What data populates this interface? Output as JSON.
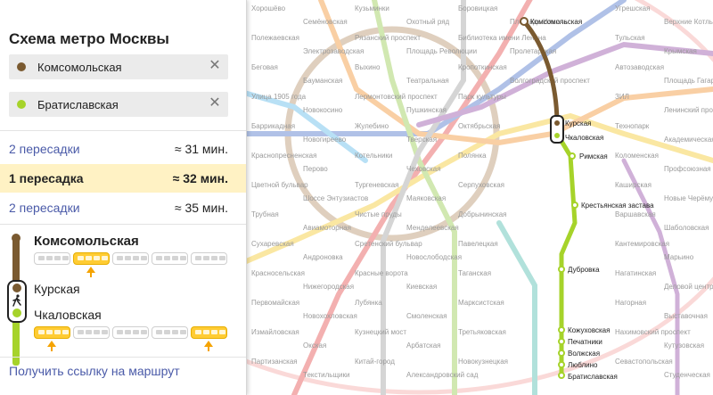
{
  "panel": {
    "title": "Схема метро Москвы",
    "from_station": "Комсомольская",
    "to_station": "Братиславская",
    "from_color": "#7a5a30",
    "to_color": "#a6d32a",
    "clear_icon": "close-icon",
    "routes": [
      {
        "label": "2 пересадки",
        "duration": "≈ 31 мин.",
        "active": false
      },
      {
        "label": "1 пересадка",
        "duration": "≈ 32 мин.",
        "active": true
      },
      {
        "label": "2 пересадки",
        "duration": "≈ 35 мин.",
        "active": false
      }
    ],
    "steps": {
      "start": "Комсомольская",
      "transfer_from": "Курская",
      "transfer_to": "Чкаловская"
    },
    "walk_icon": "walking-person-icon",
    "get_link": "Получить ссылку на маршрут"
  },
  "map": {
    "route_line_colors": {
      "koltsevaya": "#7a5a30",
      "lyublinskaya": "#a6d32a"
    },
    "route_stations": {
      "komsomolskaya": "Комсомольская",
      "kurskaya": "Курская",
      "chkalovskaya": "Чкаловская",
      "rimskaya": "Римская",
      "krestyanskaya": "Крестьянская застава",
      "dubrovka": "Дубровка",
      "kozhukhovskaya": "Кожуховская",
      "pechatniki": "Печатники",
      "volzhskaya": "Волжская",
      "lyublino": "Люблино",
      "bratislavskaya": "Братиславская"
    },
    "dim_labels": [
      "Хорошёво",
      "Полежаевская",
      "Беговая",
      "Улица 1905 года",
      "Баррикадная",
      "Краснопресненская",
      "Цветной бульвар",
      "Трубная",
      "Сухаревская",
      "Красносельская",
      "Первомайская",
      "Измайловская",
      "Партизанская",
      "Семёновская",
      "Электрозаводская",
      "Бауманская",
      "Новокосино",
      "Новогиреево",
      "Перово",
      "Шоссе Энтузиастов",
      "Авиамоторная",
      "Андроновка",
      "Нижегородская",
      "Новохохловская",
      "Окская",
      "Текстильщики",
      "Кузьминки",
      "Рязанский проспект",
      "Выхино",
      "Лермонтовский проспект",
      "Жулебино",
      "Котельники",
      "Тургеневская",
      "Чистые пруды",
      "Сретенский бульвар",
      "Красные ворота",
      "Лубянка",
      "Кузнецкий мост",
      "Китай-город",
      "Охотный ряд",
      "Площадь Революции",
      "Театральная",
      "Пушкинская",
      "Тверская",
      "Чеховская",
      "Маяковская",
      "Менделеевская",
      "Новослободская",
      "Киевская",
      "Смоленская",
      "Арбатская",
      "Александровский сад",
      "Боровицкая",
      "Библиотека имени Ленина",
      "Кропоткинская",
      "Парк культуры",
      "Октябрьская",
      "Полянка",
      "Серпуховская",
      "Добрынинская",
      "Павелецкая",
      "Таганская",
      "Марксистская",
      "Третьяковская",
      "Новокузнецкая",
      "Площадь Ильича",
      "Пролетарская",
      "Волгоградский проспект",
      "Угрешская",
      "Тульская",
      "Автозаводская",
      "ЗИЛ",
      "Технопарк",
      "Коломенская",
      "Каширская",
      "Варшавская",
      "Кантемировская",
      "Нагатинская",
      "Нагорная",
      "Нахимовский проспект",
      "Севастопольская",
      "Верхние Котлы",
      "Крымская",
      "Площадь Гагарина",
      "Ленинский проспект",
      "Академическая",
      "Профсоюзная",
      "Новые Черёмушки",
      "Шаболовская",
      "Марьино",
      "Деловой центр",
      "Выставочная",
      "Кутузовская",
      "Студенческая"
    ]
  }
}
